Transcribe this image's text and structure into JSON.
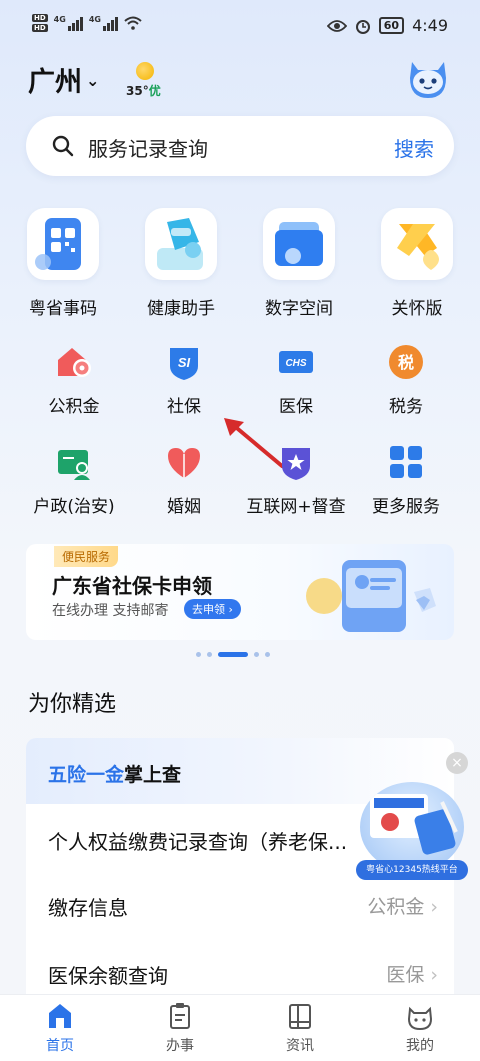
{
  "status_bar": {
    "hd1": "HD",
    "hd2": "HD",
    "sig1": "4G",
    "sig2": "4G",
    "battery": "60",
    "time": "4:49"
  },
  "header": {
    "city": "广州",
    "temperature": "35°",
    "air_quality": "优"
  },
  "search": {
    "placeholder": "服务记录查询",
    "button": "搜索"
  },
  "main_services": [
    {
      "label": "粤省事码",
      "icon": "qr-code-icon"
    },
    {
      "label": "健康助手",
      "icon": "health-assistant-icon"
    },
    {
      "label": "数字空间",
      "icon": "digital-space-icon"
    },
    {
      "label": "关怀版",
      "icon": "care-ribbon-icon"
    }
  ],
  "services": [
    {
      "label": "公积金",
      "icon": "house-fund-icon"
    },
    {
      "label": "社保",
      "icon": "social-security-icon"
    },
    {
      "label": "医保",
      "icon": "medical-insurance-icon"
    },
    {
      "label": "税务",
      "icon": "tax-icon"
    },
    {
      "label": "户政(治安)",
      "icon": "household-icon"
    },
    {
      "label": "婚姻",
      "icon": "marriage-icon"
    },
    {
      "label": "互联网+督查",
      "icon": "supervision-icon"
    },
    {
      "label": "更多服务",
      "icon": "more-services-icon"
    }
  ],
  "service_icon_text": {
    "social_security": "SI",
    "medical": "CHS",
    "tax": "税"
  },
  "banner": {
    "tag": "便民服务",
    "title": "广东省社保卡申领",
    "subtitle": "在线办理 支持邮寄",
    "button": "去申领"
  },
  "carousel": {
    "count": 5,
    "active_index": 2
  },
  "picks": {
    "section_title": "为你精选",
    "card_title_highlight": "五险一金",
    "card_title_rest": "掌上查",
    "rows": [
      {
        "name": "个人权益缴费记录查询（养老保...",
        "category": ""
      },
      {
        "name": "缴存信息",
        "category": "公积金"
      },
      {
        "name": "医保余额查询",
        "category": "医保"
      }
    ]
  },
  "float_ad": {
    "label": "粤省心12345热线平台",
    "close": "×"
  },
  "tabbar": {
    "items": [
      {
        "label": "首页",
        "icon": "home-icon",
        "active": true
      },
      {
        "label": "办事",
        "icon": "clipboard-icon",
        "active": false
      },
      {
        "label": "资讯",
        "icon": "news-icon",
        "active": false
      },
      {
        "label": "我的",
        "icon": "profile-icon",
        "active": false
      }
    ]
  },
  "colors": {
    "accent": "#2b73e8",
    "quality_good": "#18a058"
  }
}
